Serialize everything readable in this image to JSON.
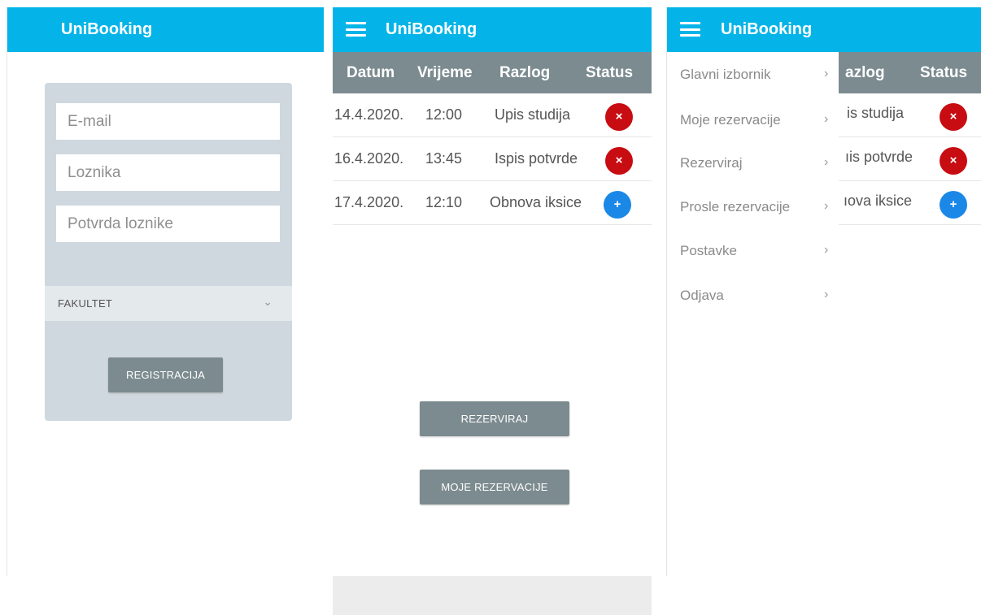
{
  "app_title": "UniBooking",
  "register": {
    "email_placeholder": "E-mail",
    "password_placeholder": "Loznika",
    "confirm_placeholder": "Potvrda loznike",
    "faculty_label": "FAKULTET",
    "register_button": "REGISTRACIJA"
  },
  "table": {
    "headers": [
      "Datum",
      "Vrijeme",
      "Razlog",
      "Status"
    ],
    "rows": [
      {
        "date": "14.4.2020.",
        "time": "12:00",
        "reason": "Upis studija",
        "status": "cancel",
        "status_symbol": "×"
      },
      {
        "date": "16.4.2020.",
        "time": "13:45",
        "reason": "Ispis potvrde",
        "status": "cancel",
        "status_symbol": "×"
      },
      {
        "date": "17.4.2020.",
        "time": "12:10",
        "reason": "Obnova iksice",
        "status": "add",
        "status_symbol": "+"
      }
    ]
  },
  "actions": {
    "reserve_button": "REZERVIRAJ",
    "my_reservations_button": "MOJE REZERVACIJE"
  },
  "menu": {
    "items": [
      "Glavni izbornik",
      "Moje rezervacije",
      "Rezerviraj",
      "Prosle rezervacije",
      "Postavke",
      "Odjava"
    ],
    "arrow": "›"
  },
  "partial": {
    "header_reason": "azlog",
    "header_status": "Status",
    "rows": [
      "is studija",
      "ıis potvrde",
      "ıova iksice"
    ]
  },
  "colors": {
    "primary": "#04b4e8",
    "table_header": "#7b8b90",
    "cancel": "#c70d12",
    "add": "#1b88e8",
    "card": "#cfd8de"
  }
}
